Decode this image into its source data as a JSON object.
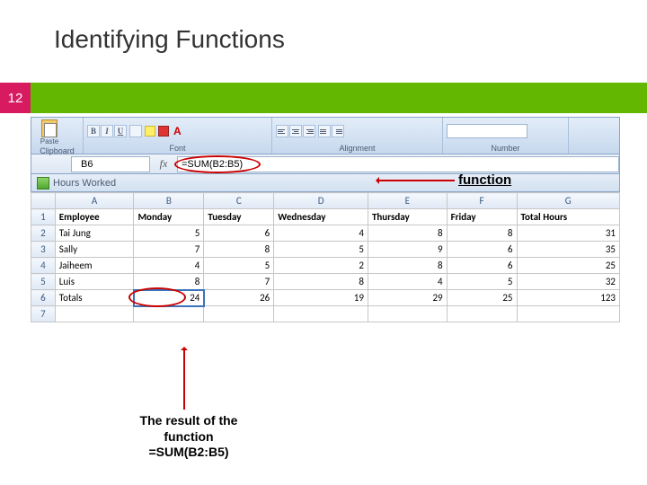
{
  "slide": {
    "title": "Identifying Functions",
    "page": "12"
  },
  "ribbon": {
    "paste_label": "Paste",
    "group_clipboard": "Clipboard",
    "group_font": "Font",
    "group_alignment": "Alignment",
    "group_number": "Number",
    "bold": "B",
    "italic": "I",
    "underline": "U"
  },
  "formula_bar": {
    "cell_ref": "B6",
    "fx": "fx",
    "formula": "=SUM(B2:B5)"
  },
  "workbook": {
    "title": "Hours Worked"
  },
  "columns": [
    "A",
    "B",
    "C",
    "D",
    "E",
    "F",
    "G"
  ],
  "row_nums": [
    "1",
    "2",
    "3",
    "4",
    "5",
    "6",
    "7"
  ],
  "headers": {
    "a": "Employee",
    "b": "Monday",
    "c": "Tuesday",
    "d": "Wednesday",
    "e": "Thursday",
    "f": "Friday",
    "g": "Total Hours"
  },
  "data": [
    {
      "a": "Tai Jung",
      "b": "5",
      "c": "6",
      "d": "4",
      "e": "8",
      "f": "8",
      "g": "31"
    },
    {
      "a": "Sally",
      "b": "7",
      "c": "8",
      "d": "5",
      "e": "9",
      "f": "6",
      "g": "35"
    },
    {
      "a": "Jaiheem",
      "b": "4",
      "c": "5",
      "d": "2",
      "e": "8",
      "f": "6",
      "g": "25"
    },
    {
      "a": "Luis",
      "b": "8",
      "c": "7",
      "d": "8",
      "e": "4",
      "f": "5",
      "g": "32"
    }
  ],
  "totals": {
    "a": "Totals",
    "b": "24",
    "c": "26",
    "d": "19",
    "e": "29",
    "f": "25",
    "g": "123"
  },
  "callouts": {
    "function": "function",
    "result_l1": "The result of the",
    "result_l2": "function",
    "result_l3": "=SUM(B2:B5)"
  },
  "chart_data": {
    "type": "table",
    "title": "Hours Worked",
    "columns": [
      "Employee",
      "Monday",
      "Tuesday",
      "Wednesday",
      "Thursday",
      "Friday",
      "Total Hours"
    ],
    "rows": [
      [
        "Tai Jung",
        5,
        6,
        4,
        8,
        8,
        31
      ],
      [
        "Sally",
        7,
        8,
        5,
        9,
        6,
        35
      ],
      [
        "Jaiheem",
        4,
        5,
        2,
        8,
        6,
        25
      ],
      [
        "Luis",
        8,
        7,
        8,
        4,
        5,
        32
      ],
      [
        "Totals",
        24,
        26,
        19,
        29,
        25,
        123
      ]
    ],
    "highlighted_cell": "B6",
    "highlighted_formula": "=SUM(B2:B5)"
  }
}
